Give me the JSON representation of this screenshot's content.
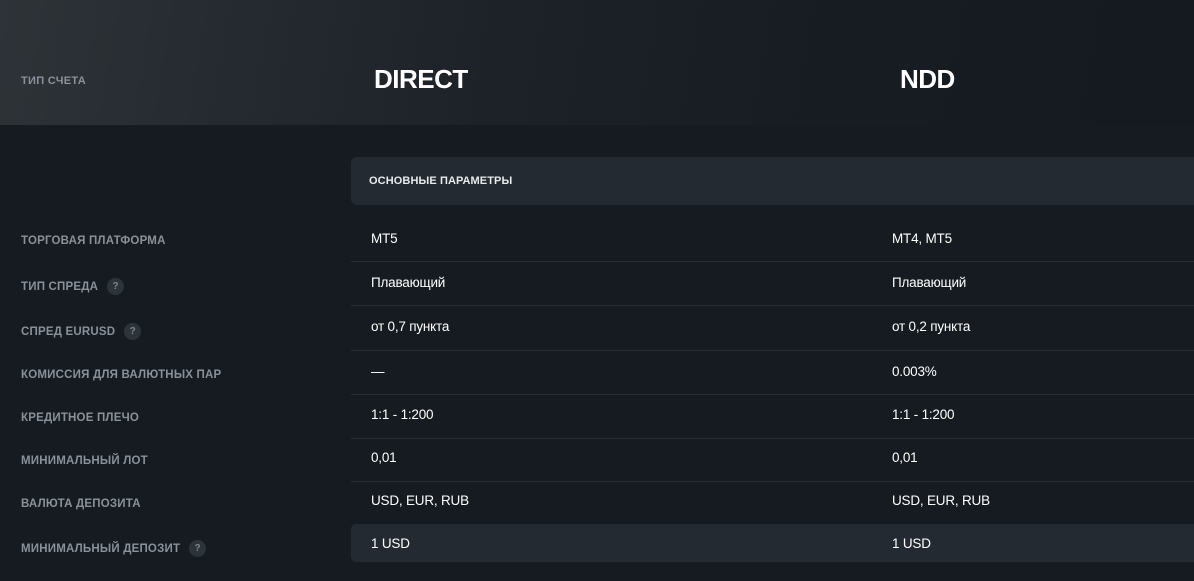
{
  "header": {
    "label": "ТИП СЧЕТА",
    "accounts": [
      "DIRECT",
      "NDD"
    ]
  },
  "section": {
    "title": "ОСНОВНЫЕ ПАРАМЕТРЫ"
  },
  "rows": [
    {
      "label": "ТОРГОВАЯ ПЛАТФОРМА",
      "has_help": false,
      "direct": "MT5",
      "ndd": "MT4, MT5"
    },
    {
      "label": "ТИП СПРЕДА",
      "has_help": true,
      "direct": "Плавающий",
      "ndd": "Плавающий"
    },
    {
      "label": "СПРЕД EURUSD",
      "has_help": true,
      "direct": "от 0,7 пункта",
      "ndd": "от 0,2 пункта"
    },
    {
      "label": "КОМИССИЯ ДЛЯ ВАЛЮТНЫХ ПАР",
      "has_help": false,
      "direct": "—",
      "ndd": "0.003%"
    },
    {
      "label": "КРЕДИТНОЕ ПЛЕЧО",
      "has_help": false,
      "direct": "1:1 - 1:200",
      "ndd": "1:1 - 1:200"
    },
    {
      "label": "МИНИМАЛЬНЫЙ ЛОТ",
      "has_help": false,
      "direct": "0,01",
      "ndd": "0,01"
    },
    {
      "label": "ВАЛЮТА ДЕПОЗИТА",
      "has_help": false,
      "direct": "USD, EUR, RUB",
      "ndd": "USD, EUR, RUB"
    },
    {
      "label": "МИНИМАЛЬНЫЙ ДЕПОЗИТ",
      "has_help": true,
      "direct": "1 USD",
      "ndd": "1 USD"
    }
  ],
  "help_icon_glyph": "?",
  "icons": {
    "help": "question-circle-icon"
  },
  "colors": {
    "background": "#151b21",
    "label": "#8a9199",
    "panel": "#232a31",
    "text": "#ffffff"
  }
}
